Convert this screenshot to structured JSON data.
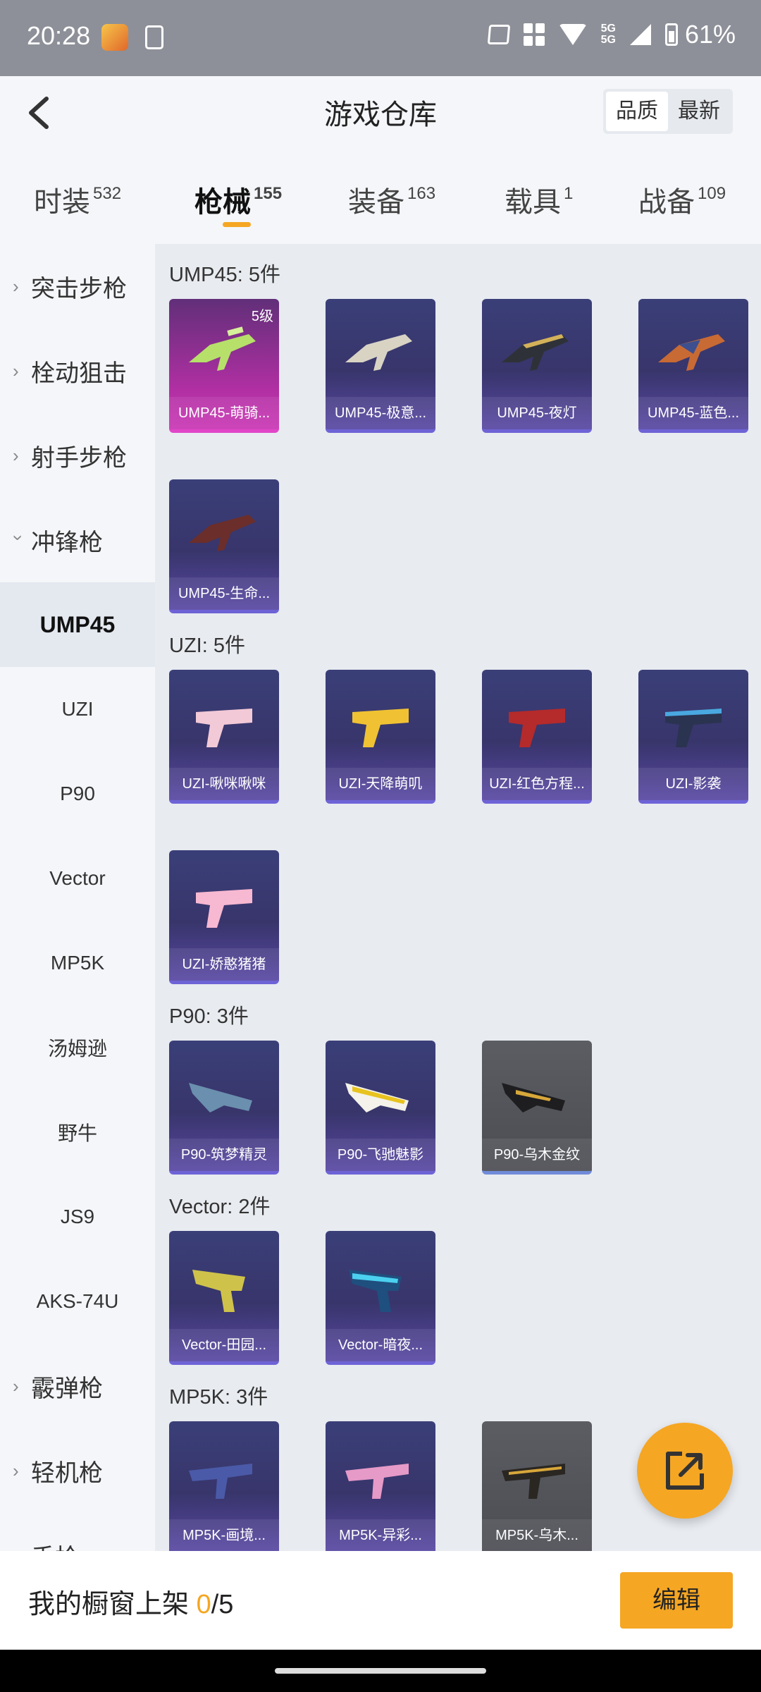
{
  "status_bar": {
    "time": "20:28",
    "network": "5G",
    "network2": "5G",
    "battery": "61%"
  },
  "header": {
    "title": "游戏仓库",
    "sort_options": [
      "品质",
      "最新"
    ]
  },
  "tabs": [
    {
      "label": "时装",
      "count": "532"
    },
    {
      "label": "枪械",
      "count": "155"
    },
    {
      "label": "装备",
      "count": "163"
    },
    {
      "label": "载具",
      "count": "1"
    },
    {
      "label": "战备",
      "count": "109"
    }
  ],
  "sidebar": {
    "categories": [
      "突击步枪",
      "栓动狙击",
      "射手步枪",
      "冲锋枪",
      "霰弹枪",
      "轻机枪",
      "手枪"
    ],
    "subcategories": [
      "UMP45",
      "UZI",
      "P90",
      "Vector",
      "MP5K",
      "汤姆逊",
      "野牛",
      "JS9",
      "AKS-74U"
    ]
  },
  "sections": [
    {
      "title": "UMP45: 5件",
      "items": [
        {
          "name": "UMP45-萌骑...",
          "level": "5级"
        },
        {
          "name": "UMP45-极意..."
        },
        {
          "name": "UMP45-夜灯"
        },
        {
          "name": "UMP45-蓝色..."
        },
        {
          "name": "UMP45-生命..."
        }
      ]
    },
    {
      "title": "UZI: 5件",
      "items": [
        {
          "name": "UZI-啾咪啾咪"
        },
        {
          "name": "UZI-天降萌叽"
        },
        {
          "name": "UZI-红色方程..."
        },
        {
          "name": "UZI-影袭"
        },
        {
          "name": "UZI-娇憨猪猪"
        }
      ]
    },
    {
      "title": "P90: 3件",
      "items": [
        {
          "name": "P90-筑梦精灵"
        },
        {
          "name": "P90-飞驰魅影"
        },
        {
          "name": "P90-乌木金纹"
        }
      ]
    },
    {
      "title": "Vector: 2件",
      "items": [
        {
          "name": "Vector-田园..."
        },
        {
          "name": "Vector-暗夜..."
        }
      ]
    },
    {
      "title": "MP5K: 3件",
      "items": [
        {
          "name": "MP5K-画境..."
        },
        {
          "name": "MP5K-异彩..."
        },
        {
          "name": "MP5K-乌木..."
        }
      ]
    }
  ],
  "bottom_bar": {
    "shelf_label": "我的橱窗上架 ",
    "shelf_current": "0",
    "shelf_total": "/5",
    "edit_label": "编辑"
  },
  "colors": {
    "accent": "#f5a623",
    "card_purple": "#3a3f78",
    "card_pink": "#b12fa3",
    "card_grey": "#55575d"
  }
}
